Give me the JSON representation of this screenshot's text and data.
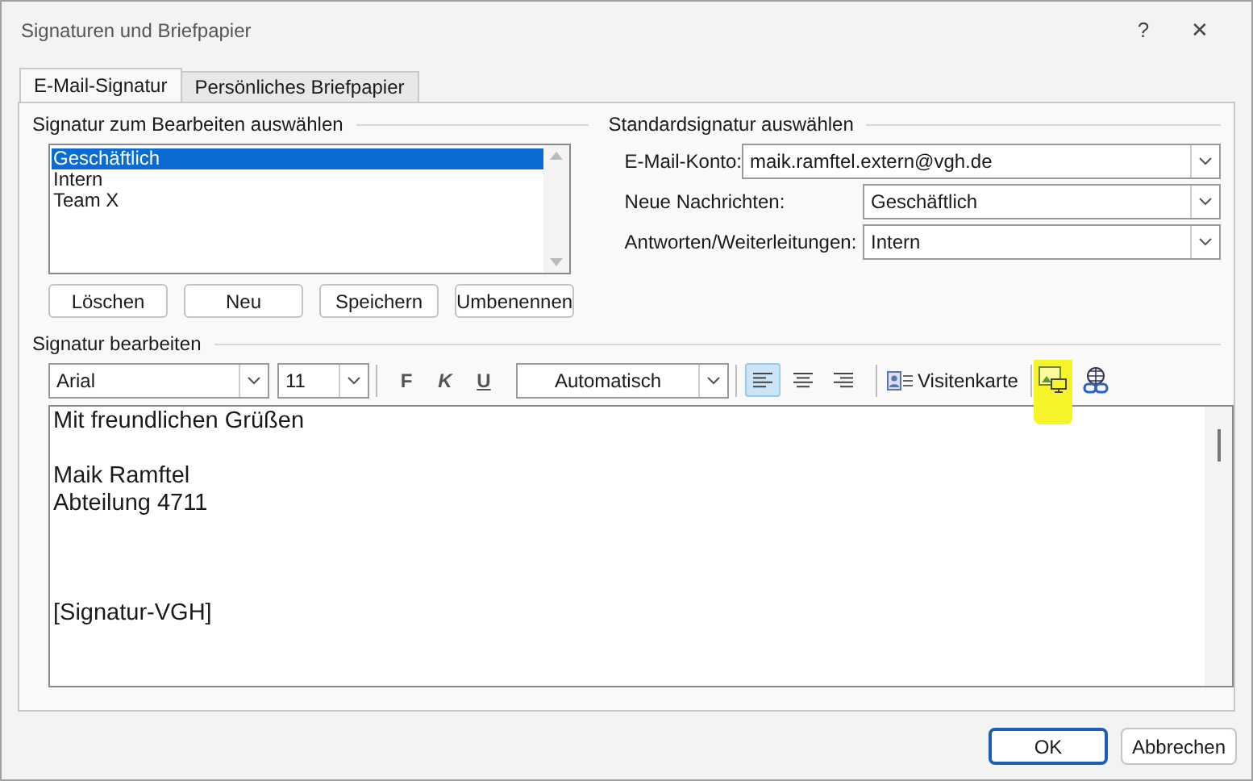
{
  "window": {
    "title": "Signaturen und Briefpapier",
    "help": "?",
    "close": "✕"
  },
  "tabs": [
    {
      "label": "E-Mail-Signatur",
      "selected": true
    },
    {
      "label": "Persönliches Briefpapier",
      "selected": false
    }
  ],
  "select_section": {
    "title": "Signatur zum Bearbeiten auswählen",
    "items": [
      {
        "label": "Geschäftlich",
        "selected": true
      },
      {
        "label": "Intern",
        "selected": false
      },
      {
        "label": "Team X",
        "selected": false
      }
    ],
    "buttons": [
      "Löschen",
      "Neu",
      "Speichern",
      "Umbenennen"
    ]
  },
  "default_section": {
    "title": "Standardsignatur auswählen",
    "fields": [
      {
        "label": "E-Mail-Konto:",
        "value": "maik.ramftel.extern@vgh.de"
      },
      {
        "label": "Neue Nachrichten:",
        "value": "Geschäftlich"
      },
      {
        "label": "Antworten/Weiterleitungen:",
        "value": "Intern"
      }
    ]
  },
  "editor": {
    "title": "Signatur bearbeiten",
    "font": "Arial",
    "size": "11",
    "format_buttons": [
      {
        "label": "F",
        "kind": "bold"
      },
      {
        "label": "K",
        "kind": "italic"
      },
      {
        "label": "U",
        "kind": "underline"
      }
    ],
    "color_label": "Automatisch",
    "align": [
      {
        "kind": "left",
        "selected": true
      },
      {
        "kind": "center",
        "selected": false
      },
      {
        "kind": "right",
        "selected": false
      }
    ],
    "business_card": "Visitenkarte",
    "lines": [
      {
        "kind": "text",
        "text": "Mit freundlichen Grüßen"
      },
      {
        "kind": "blank"
      },
      {
        "kind": "text",
        "text": "Maik Ramftel"
      },
      {
        "kind": "text",
        "text": "Abteilung 4711"
      },
      {
        "kind": "blank"
      },
      {
        "kind": "blank"
      },
      {
        "kind": "blank"
      },
      {
        "kind": "text",
        "text": "[Signatur-VGH]"
      }
    ]
  },
  "buttons": [
    {
      "label": "OK",
      "default": true
    },
    {
      "label": "Abbrechen",
      "default": false
    }
  ]
}
